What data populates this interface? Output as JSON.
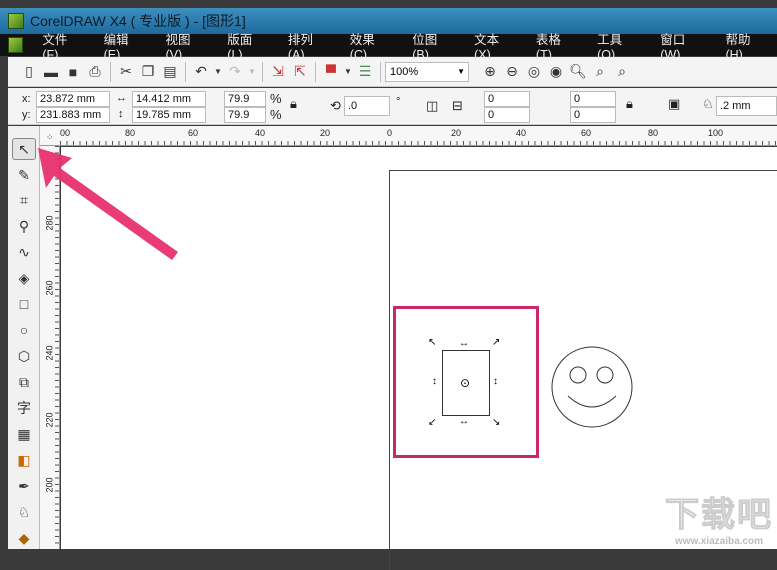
{
  "title": "CorelDRAW X4 ( 专业版 ) - [图形1]",
  "menu": [
    "文件(F)",
    "编辑(E)",
    "视图(V)",
    "版面(L)",
    "排列(A)",
    "效果(C)",
    "位图(B)",
    "文本(X)",
    "表格(T)",
    "工具(O)",
    "窗口(W)",
    "帮助(H)"
  ],
  "toolbar": {
    "zoom": "100%"
  },
  "props": {
    "x_label": "x:",
    "y_label": "y:",
    "x": "23.872 mm",
    "y": "231.883 mm",
    "w": "14.412 mm",
    "h": "19.785 mm",
    "sx": "79.9",
    "sy": "79.9",
    "pct": "%",
    "rot": ".0",
    "deg": "°",
    "c1": "0",
    "c2": "0",
    "c3": "0",
    "c4": "0",
    "outline": ".2 mm"
  },
  "ruler_h": [
    "00",
    "80",
    "60",
    "40",
    "20",
    "0",
    "20",
    "40",
    "60",
    "80",
    "100"
  ],
  "ruler_v": [
    "280",
    "260",
    "240",
    "220",
    "200"
  ],
  "tools": {
    "text": "字"
  },
  "watermark": {
    "main": "下载吧",
    "url": "www.xiazaiba.com"
  },
  "colors": {
    "highlight": "#c8286a",
    "arrow": "#e8306e"
  }
}
